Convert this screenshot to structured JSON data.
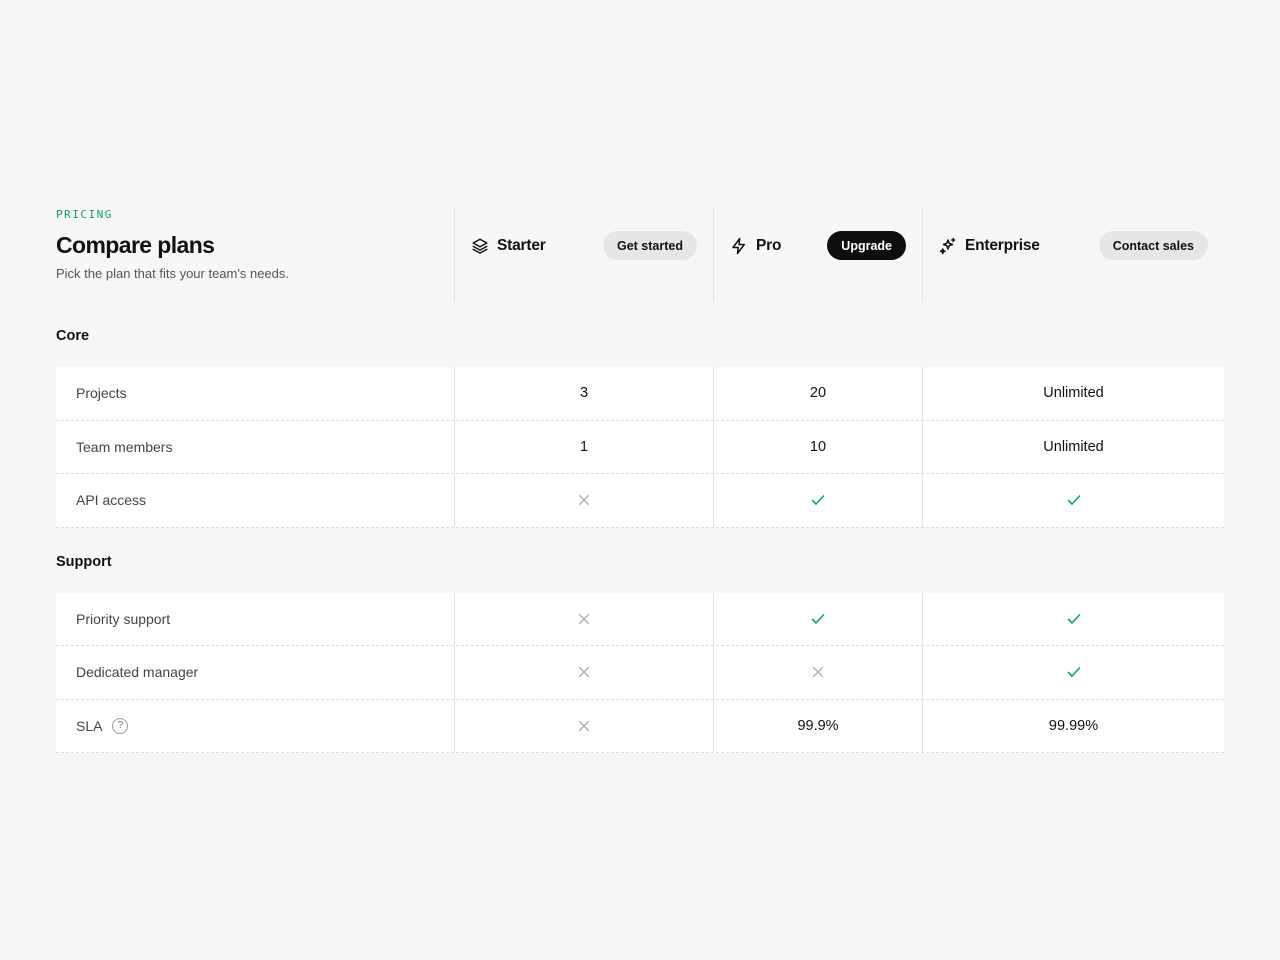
{
  "header": {
    "eyebrow": "PRICING",
    "title": "Compare plans",
    "subtitle": "Pick the plan that fits your team's needs."
  },
  "plans": [
    {
      "name": "Starter",
      "icon": "layers-icon",
      "button": "Get started",
      "button_style": "light"
    },
    {
      "name": "Pro",
      "icon": "lightning-icon",
      "button": "Upgrade",
      "button_style": "dark"
    },
    {
      "name": "Enterprise",
      "icon": "sparkles-icon",
      "button": "Contact sales",
      "button_style": "light"
    }
  ],
  "sections": [
    {
      "title": "Core",
      "rows": [
        {
          "label": "Projects",
          "values": [
            "3",
            "20",
            "Unlimited"
          ]
        },
        {
          "label": "Team members",
          "values": [
            "1",
            "10",
            "Unlimited"
          ]
        },
        {
          "label": "API access",
          "values": [
            "cross-icon",
            "check-icon",
            "check-icon"
          ]
        }
      ]
    },
    {
      "title": "Support",
      "rows": [
        {
          "label": "Priority support",
          "values": [
            "cross-icon",
            "check-icon",
            "check-icon"
          ]
        },
        {
          "label": "Dedicated manager",
          "values": [
            "cross-icon",
            "cross-icon",
            "check-icon"
          ]
        },
        {
          "label": "SLA",
          "help_icon": "?",
          "values": [
            "cross-icon",
            "99.9%",
            "99.99%"
          ]
        }
      ]
    }
  ],
  "colors": {
    "accent": "#12a06b",
    "check": "#12a06b",
    "cross": "#b0b0b0",
    "dark_button": "#0e0e0e",
    "light_button": "#e6e6e6"
  }
}
